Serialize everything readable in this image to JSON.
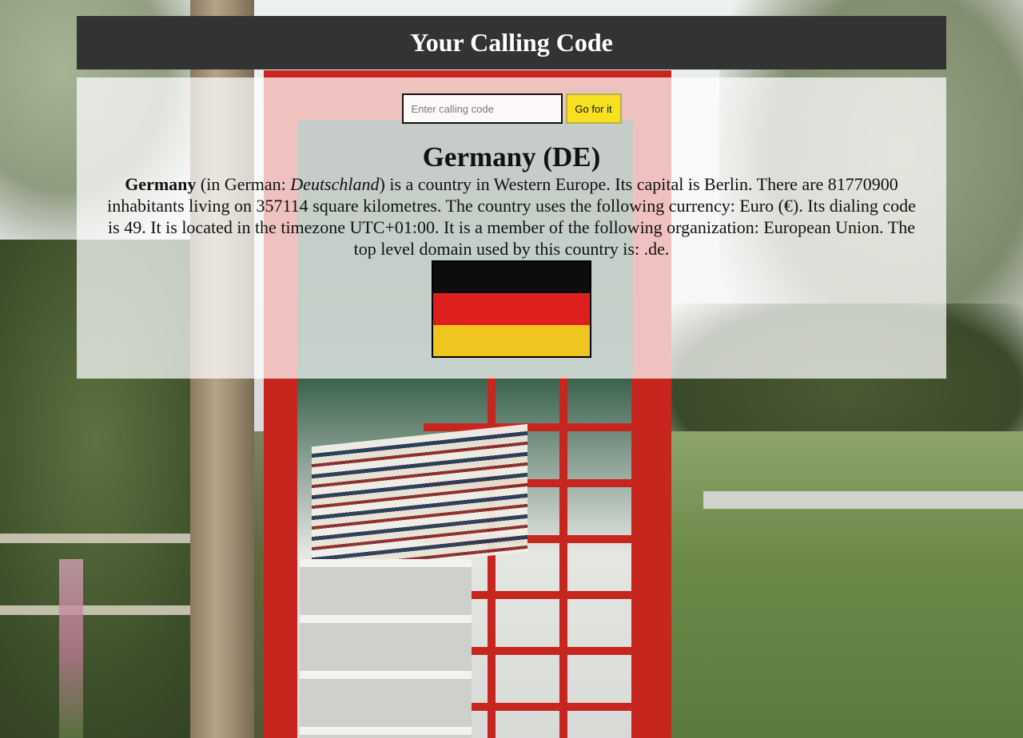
{
  "page": {
    "title": "Your Calling Code"
  },
  "search": {
    "placeholder": "Enter calling code",
    "value": "",
    "button_label": "Go for it"
  },
  "country": {
    "heading": "Germany (DE)",
    "name": "Germany",
    "native_intro": " (in German: ",
    "native_name": "Deutschland",
    "sentence_rest": ") is a country in Western Europe. Its capital is Berlin. There are 81770900 inhabitants living on 357114 square kilometres. The country uses the following currency: Euro (€). Its dialing code is 49. It is located in the timezone UTC+01:00. It is a member of the following organization: European Union. The top level domain used by this country is: .de."
  },
  "flag": {
    "name": "flag-germany",
    "stripes": [
      "#0d0d0d",
      "#dd1f1d",
      "#f0c51f"
    ]
  },
  "colors": {
    "header_bg": "#333333",
    "button_bg": "#f5e11f"
  }
}
